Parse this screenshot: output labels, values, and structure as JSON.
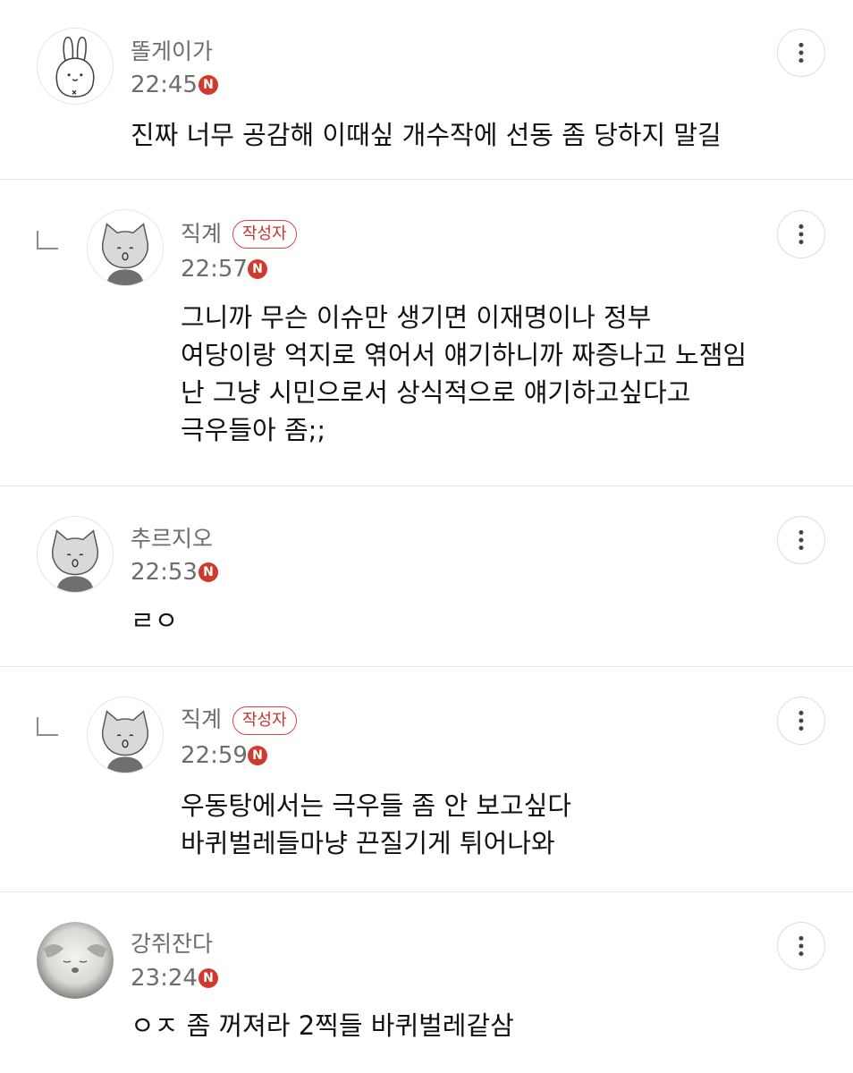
{
  "comments": [
    {
      "name": "똘게이가",
      "time": "22:45",
      "new_badge": "N",
      "avatar": "rabbit-avatar-icon",
      "is_reply": false,
      "author_badge": "",
      "lines": [
        "진짜 너무 공감해 이때싶 개수작에 선동 좀 당하지 말길"
      ]
    },
    {
      "name": "직계",
      "time": "22:57",
      "new_badge": "N",
      "avatar": "cat-avatar-icon",
      "is_reply": true,
      "author_badge": "작성자",
      "lines": [
        "그니까 무슨 이슈만 생기면 이재명이나 정부",
        "여당이랑 억지로 엮어서 얘기하니까 짜증나고 노잼임",
        "난 그냥 시민으로서 상식적으로 얘기하고싶다고",
        "극우들아 좀;;"
      ]
    },
    {
      "name": "추르지오",
      "time": "22:53",
      "new_badge": "N",
      "avatar": "cat-avatar-icon",
      "is_reply": false,
      "author_badge": "",
      "lines": [
        "ㄹㅇ"
      ]
    },
    {
      "name": "직계",
      "time": "22:59",
      "new_badge": "N",
      "avatar": "cat-avatar-icon",
      "is_reply": true,
      "author_badge": "작성자",
      "lines": [
        "우동탕에서는 극우들 좀 안 보고싶다",
        "바퀴벌레들마냥 끈질기게 튀어나와"
      ]
    },
    {
      "name": "강쥐잔다",
      "time": "23:24",
      "new_badge": "N",
      "avatar": "photo-avatar-icon",
      "is_reply": false,
      "author_badge": "",
      "lines": [
        "ㅇㅈ 좀 꺼져라 2찍들 바퀴벌레같삼"
      ]
    }
  ],
  "icons": {
    "more": "more-vertical-icon",
    "reply": "reply-arrow-icon",
    "new": "new-badge-icon"
  },
  "colors": {
    "new_badge": "#d03a2b",
    "author_badge": "#c8342c",
    "meta_text": "#6d6d6d",
    "divider": "#e6e6e6"
  }
}
